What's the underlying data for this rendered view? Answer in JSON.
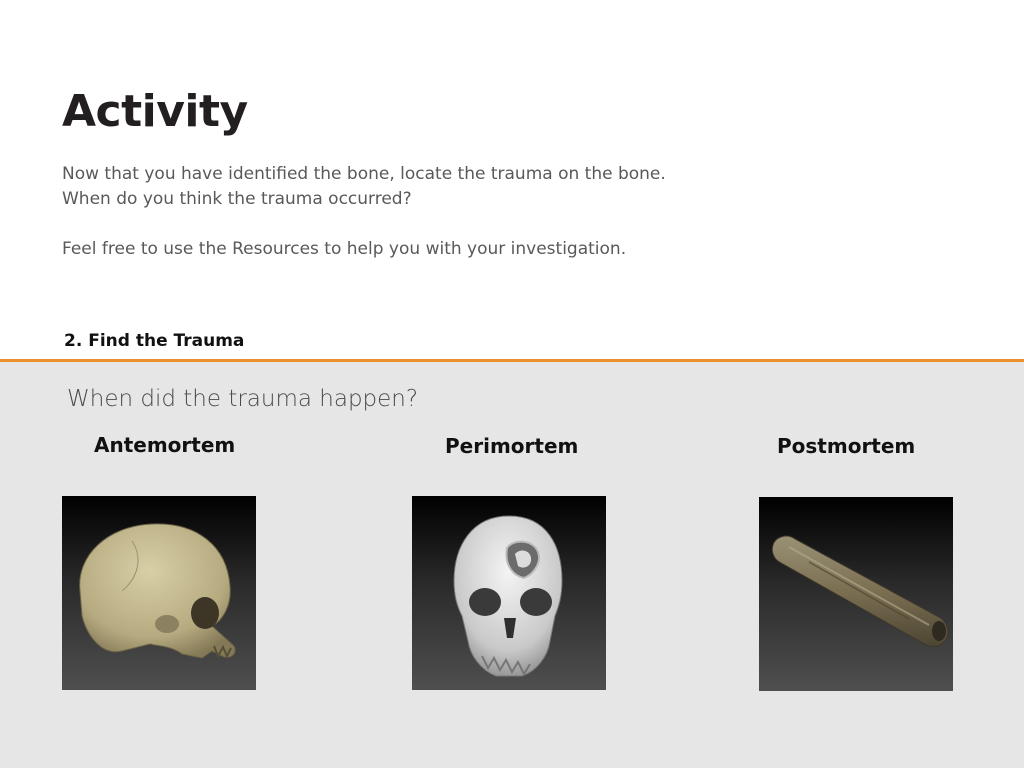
{
  "page": {
    "title": "Activity",
    "instructions": [
      "Now that you have identified the bone, locate the trauma on the bone.",
      "When do you think the trauma occurred?",
      "Feel free to use the Resources to help you with your investigation."
    ],
    "step_label": "2. Find the Trauma"
  },
  "quiz": {
    "question": "When did the trauma happen?",
    "options": [
      {
        "label": "Antemortem",
        "image": "skull-side-icon"
      },
      {
        "label": "Perimortem",
        "image": "skull-front-fractured-icon"
      },
      {
        "label": "Postmortem",
        "image": "long-bone-icon"
      }
    ]
  },
  "colors": {
    "accent": "#e8912d",
    "panel_bg": "#e6e6e7",
    "title": "#231f20",
    "body_text": "#58595b"
  }
}
